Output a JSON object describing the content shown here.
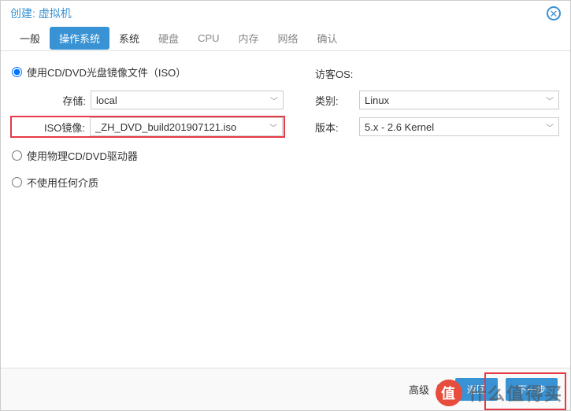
{
  "dialog": {
    "title": "创建: 虚拟机"
  },
  "tabs": {
    "general": "一般",
    "os": "操作系统",
    "system": "系统",
    "disk": "硬盘",
    "cpu": "CPU",
    "memory": "内存",
    "network": "网络",
    "confirm": "确认"
  },
  "radios": {
    "iso": "使用CD/DVD光盘镜像文件（ISO）",
    "physical": "使用物理CD/DVD驱动器",
    "none": "不使用任何介质"
  },
  "left": {
    "storage_label": "存储:",
    "storage_value": "local",
    "iso_label": "ISO镜像:",
    "iso_value": "_ZH_DVD_build201907121.iso"
  },
  "right": {
    "guest_label": "访客OS:",
    "type_label": "类别:",
    "type_value": "Linux",
    "version_label": "版本:",
    "version_value": "5.x - 2.6 Kernel"
  },
  "footer": {
    "advanced": "高级",
    "back": "返回",
    "next": "下一步"
  },
  "watermark": {
    "text": "什么值得买",
    "logo": "值"
  }
}
